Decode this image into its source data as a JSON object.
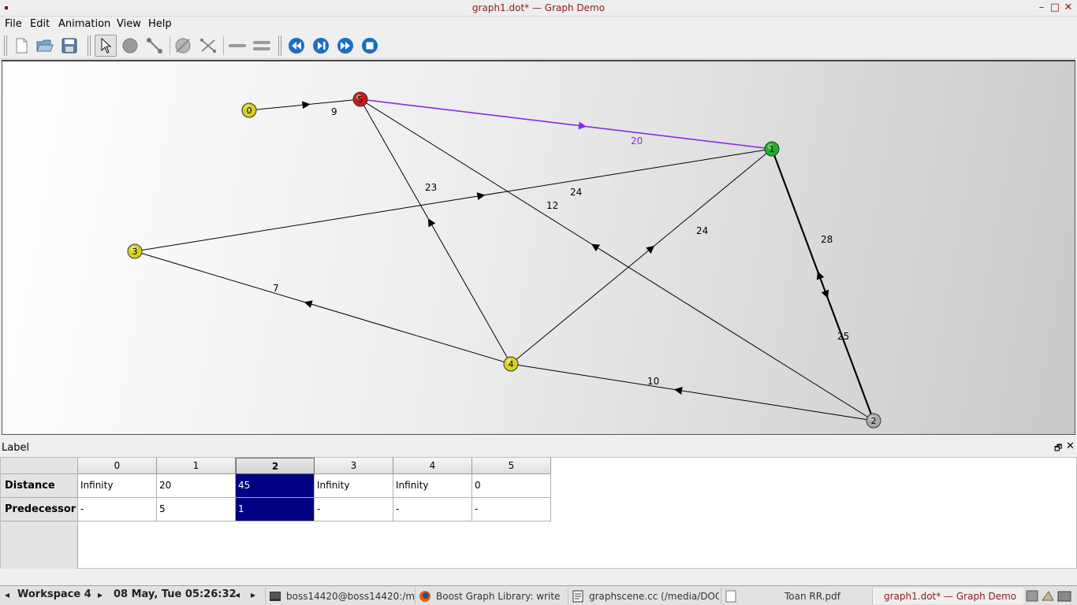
{
  "window": {
    "title": "graph1.dot* — Graph Demo",
    "minimize_glyph": "–",
    "maximize_glyph": "□",
    "close_glyph": "✕"
  },
  "menu": [
    "File",
    "Edit",
    "Animation",
    "View",
    "Help"
  ],
  "toolbar": {
    "buttons": [
      "new-file-icon",
      "open-file-icon",
      "save-file-icon",
      "select-pointer-icon",
      "add-node-icon",
      "add-edge-icon",
      "delete-node-icon",
      "delete-edge-icon",
      "undirected-edge-icon",
      "directed-edge-icon",
      "rewind-icon",
      "step-icon",
      "fast-forward-icon",
      "stop-icon"
    ],
    "media_color": "#1a6fc4"
  },
  "graph": {
    "nodes": [
      {
        "id": "0",
        "color": "#d8d020"
      },
      {
        "id": "1",
        "color": "#22b022"
      },
      {
        "id": "2",
        "color": "#aaaaaa"
      },
      {
        "id": "3",
        "color": "#d8d020"
      },
      {
        "id": "4",
        "color": "#d8d020"
      },
      {
        "id": "5",
        "color": "#cc1a1a"
      }
    ],
    "edges": [
      {
        "from": "0",
        "to": "5",
        "weight": "9",
        "style": "normal"
      },
      {
        "from": "5",
        "to": "1",
        "weight": "20",
        "style": "highlight"
      },
      {
        "from": "3",
        "to": "1",
        "weight": "24",
        "style": "normal"
      },
      {
        "from": "4",
        "to": "5",
        "weight": "23",
        "style": "normal"
      },
      {
        "from": "2",
        "to": "5",
        "weight": "12",
        "style": "normal"
      },
      {
        "from": "4",
        "to": "1",
        "weight": "24",
        "style": "normal"
      },
      {
        "from": "2",
        "to": "1",
        "weight": "28",
        "style": "bold"
      },
      {
        "from": "1",
        "to": "2",
        "weight": "25",
        "style": "bold"
      },
      {
        "from": "4",
        "to": "3",
        "weight": "7",
        "style": "normal"
      },
      {
        "from": "2",
        "to": "4",
        "weight": "10",
        "style": "normal"
      }
    ],
    "highlight_color": "#8a2be2"
  },
  "dock": {
    "title": "Label",
    "float_glyph": "🗗",
    "close_glyph": "✕",
    "columns": [
      "0",
      "1",
      "2",
      "3",
      "4",
      "5"
    ],
    "selected_column": "2",
    "rows": [
      {
        "label": "Distance",
        "values": [
          "Infinity",
          "20",
          "45",
          "Infinity",
          "Infinity",
          "0"
        ]
      },
      {
        "label": "Predecessor",
        "values": [
          "-",
          "5",
          "1",
          "-",
          "-",
          "-"
        ]
      }
    ]
  },
  "taskbar": {
    "workspace": "Workspace 4",
    "left_arrow": "◂",
    "right_arrow": "▸",
    "datetime": "08 May, Tue 05:26:32",
    "prev": "◂",
    "next": "▸",
    "tasks": [
      {
        "label": "boss14420@boss14420:/me",
        "icon": "terminal-icon"
      },
      {
        "label": "Boost Graph Library: write",
        "icon": "firefox-icon"
      },
      {
        "label": "graphscene.cc (/media/DOC",
        "icon": "editor-icon"
      },
      {
        "label": "Toan RR.pdf",
        "icon": "pdf-icon"
      },
      {
        "label": "graph1.dot* — Graph Demo",
        "icon": "app-icon",
        "active": true
      }
    ]
  }
}
